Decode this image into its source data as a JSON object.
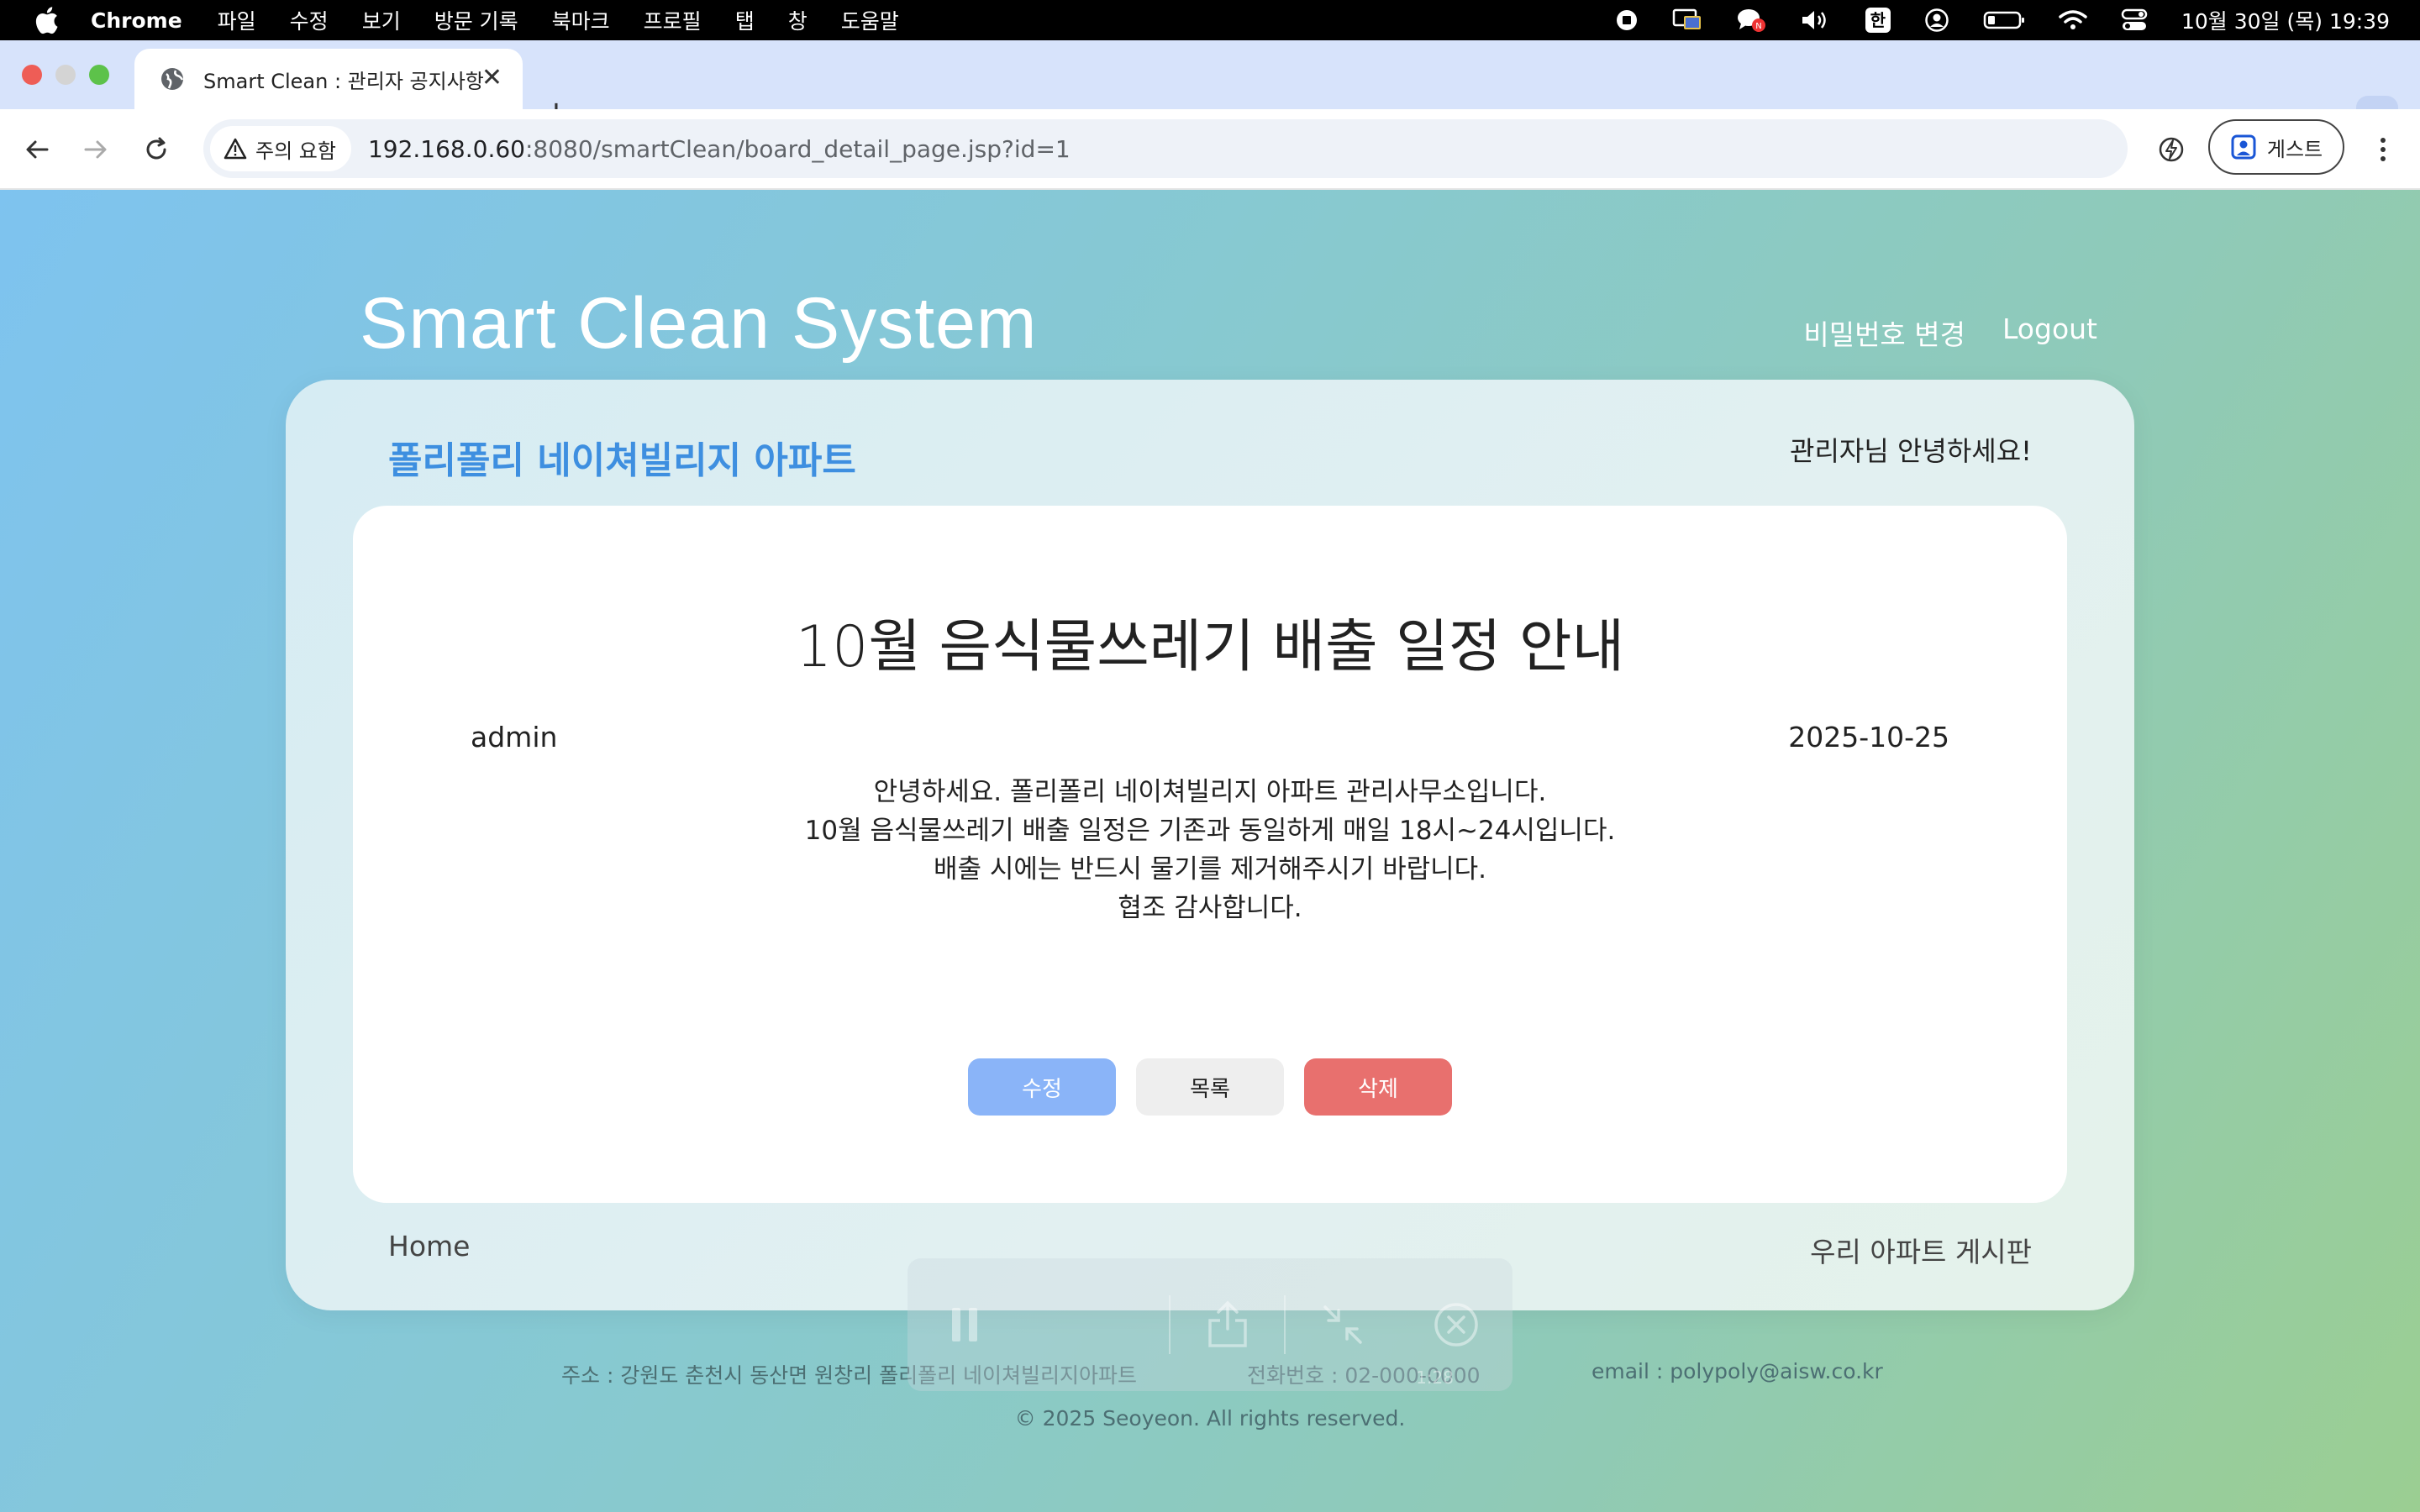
{
  "menubar": {
    "app": "Chrome",
    "items": [
      "파일",
      "수정",
      "보기",
      "방문 기록",
      "북마크",
      "프로필",
      "탭",
      "창",
      "도움말"
    ],
    "ime": "한",
    "clock": "10월 30일 (목) 19:39"
  },
  "tab": {
    "title": "Smart Clean : 관리자 공지사항"
  },
  "toolbar": {
    "security_label": "주의 요함",
    "url_host": "192.168.0.60",
    "url_rest": ":8080/smartClean/board_detail_page.jsp?id=1",
    "profile_label": "게스트"
  },
  "site": {
    "title": "Smart Clean System",
    "nav": [
      "비밀번호 변경",
      "Logout"
    ],
    "apartment": "폴리폴리 네이쳐빌리지 아파트",
    "greeting": "관리자님 안녕하세요!"
  },
  "post": {
    "title": "10월 음식물쓰레기 배출 일정 안내",
    "author": "admin",
    "date": "2025-10-25",
    "body": [
      "안녕하세요. 폴리폴리 네이쳐빌리지 아파트 관리사무소입니다.",
      "10월 음식물쓰레기 배출 일정은 기존과 동일하게 매일 18시~24시입니다.",
      "배출 시에는 반드시 물기를 제거해주시기 바랍니다.",
      "협조 감사합니다."
    ],
    "buttons": {
      "edit": "수정",
      "list": "목록",
      "delete": "삭제"
    }
  },
  "card_footer": {
    "home": "Home",
    "board": "우리 아파트 게시판"
  },
  "footer": {
    "address": "주소 : 강원도 춘천시 동산면 원창리 폴리폴리 네이쳐빌리지아파트",
    "phone": "전화번호 : 02-000-0000",
    "email": "email : polypoly@aisw.co.kr",
    "copyright": "© 2025 Seoyeon. All rights reserved."
  },
  "recorder": {
    "time": "1:28"
  },
  "colors": {
    "accent_blue": "#3e8fe0",
    "edit_button": "#8ab4f8",
    "delete_button": "#e8706e"
  }
}
